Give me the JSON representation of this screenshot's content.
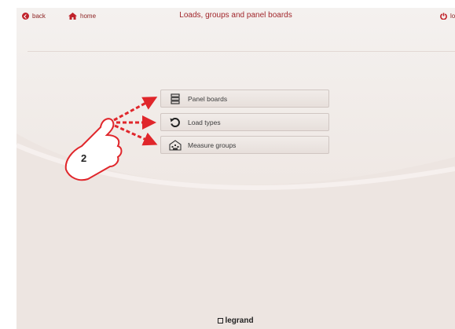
{
  "nav": {
    "back_label": "back",
    "home_label": "home",
    "logout_label": "logo"
  },
  "header": {
    "title": "Loads, groups and panel boards"
  },
  "menu": {
    "items": [
      {
        "label": "Panel boards",
        "icon": "panel-board-icon"
      },
      {
        "label": "Load types",
        "icon": "load-types-icon"
      },
      {
        "label": "Measure groups",
        "icon": "measure-groups-icon"
      }
    ]
  },
  "footer": {
    "brand": "legrand"
  },
  "annotation": {
    "step_number": "2"
  },
  "colors": {
    "accent": "#c0222a",
    "title": "#a1262b",
    "arrow": "#e0262b"
  }
}
